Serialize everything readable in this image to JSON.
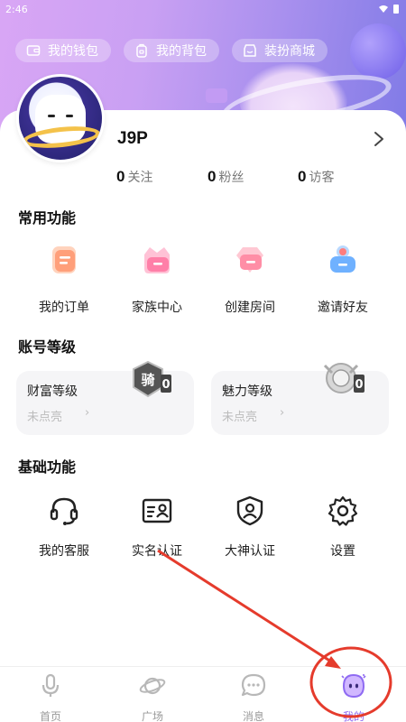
{
  "status": {
    "time": "2:46"
  },
  "top_pills": [
    {
      "label": "我的钱包",
      "icon": "wallet-icon"
    },
    {
      "label": "我的背包",
      "icon": "backpack-icon"
    },
    {
      "label": "装扮商城",
      "icon": "shop-icon"
    }
  ],
  "profile": {
    "username": "J9P",
    "stats": [
      {
        "value": "0",
        "label": "关注"
      },
      {
        "value": "0",
        "label": "粉丝"
      },
      {
        "value": "0",
        "label": "访客"
      }
    ]
  },
  "common": {
    "title": "常用功能",
    "items": [
      {
        "label": "我的订单",
        "icon": "order-icon"
      },
      {
        "label": "家族中心",
        "icon": "family-icon"
      },
      {
        "label": "创建房间",
        "icon": "create-room-icon"
      },
      {
        "label": "邀请好友",
        "icon": "invite-friend-icon"
      }
    ]
  },
  "level": {
    "title": "账号等级",
    "cards": [
      {
        "title": "财富等级",
        "status": "未点亮",
        "badge_text": "骑",
        "badge_num": "0"
      },
      {
        "title": "魅力等级",
        "status": "未点亮",
        "badge_num": "0"
      }
    ]
  },
  "basic": {
    "title": "基础功能",
    "items": [
      {
        "label": "我的客服",
        "icon": "headset-icon"
      },
      {
        "label": "实名认证",
        "icon": "id-card-icon"
      },
      {
        "label": "大神认证",
        "icon": "shield-user-icon"
      },
      {
        "label": "设置",
        "icon": "gear-icon"
      }
    ]
  },
  "tabbar": {
    "items": [
      {
        "label": "首页",
        "icon": "mic-icon",
        "active": false
      },
      {
        "label": "广场",
        "icon": "planet-icon",
        "active": false
      },
      {
        "label": "消息",
        "icon": "chat-icon",
        "active": false
      },
      {
        "label": "我的",
        "icon": "me-ghost-icon",
        "active": true
      }
    ]
  },
  "colors": {
    "accent": "#8f6bf2",
    "annotation": "#e53b2c",
    "gradient_start": "#d9a6f5",
    "gradient_end": "#7f7ae6"
  }
}
